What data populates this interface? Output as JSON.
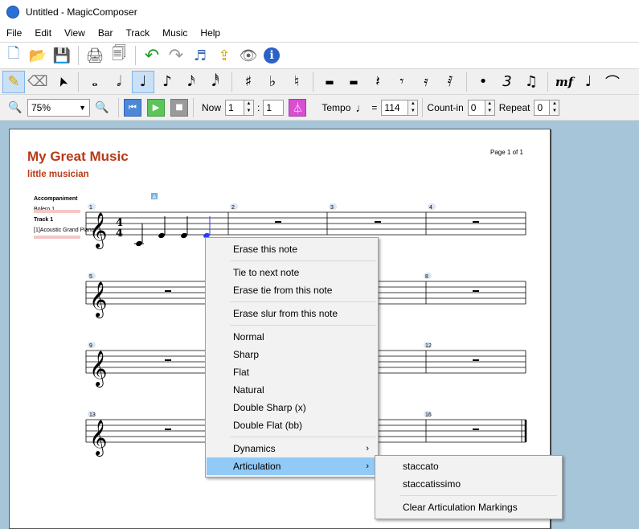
{
  "window": {
    "title": "Untitled - MagicComposer"
  },
  "menu": [
    "File",
    "Edit",
    "View",
    "Bar",
    "Track",
    "Music",
    "Help"
  ],
  "toolbar1": {
    "icons": [
      "new-document-icon",
      "open-folder-icon",
      "save-icon",
      "print-icon",
      "print-preview-icon",
      "undo-icon",
      "redo-icon",
      "score-settings-icon",
      "import-icon",
      "view-icon",
      "info-icon"
    ],
    "glyphs": [
      "🗋",
      "📂",
      "💾",
      "🖨",
      "🗐",
      "↶",
      "↷",
      "♬",
      "⇪",
      "👁",
      "ℹ"
    ]
  },
  "toolbar2": {
    "tools": [
      {
        "name": "pencil-icon",
        "glyph": "✎",
        "active": true
      },
      {
        "name": "eraser-icon",
        "glyph": "⌫",
        "active": false
      },
      {
        "name": "pointer-icon",
        "glyph": "➤",
        "active": false
      }
    ],
    "notes": [
      {
        "name": "whole-note-icon",
        "glyph": "𝅝",
        "active": false
      },
      {
        "name": "half-note-icon",
        "glyph": "𝅗𝅥",
        "active": false
      },
      {
        "name": "quarter-note-icon",
        "glyph": "♩",
        "active": true
      },
      {
        "name": "eighth-note-icon",
        "glyph": "♪",
        "active": false
      },
      {
        "name": "sixteenth-note-icon",
        "glyph": "𝅘𝅥𝅯",
        "active": false
      },
      {
        "name": "thirty-second-note-icon",
        "glyph": "𝅘𝅥𝅰",
        "active": false
      }
    ],
    "accidentals": [
      {
        "name": "sharp-icon",
        "glyph": "♯"
      },
      {
        "name": "flat-icon",
        "glyph": "♭"
      },
      {
        "name": "natural-icon",
        "glyph": "♮"
      }
    ],
    "rests": [
      {
        "name": "whole-rest-icon",
        "glyph": "▬"
      },
      {
        "name": "half-rest-icon",
        "glyph": "▬"
      },
      {
        "name": "quarter-rest-icon",
        "glyph": "𝄽"
      },
      {
        "name": "eighth-rest-icon",
        "glyph": "𝄾"
      },
      {
        "name": "sixteenth-rest-icon",
        "glyph": "𝄿"
      },
      {
        "name": "thirty-second-rest-icon",
        "glyph": "𝅀"
      }
    ],
    "extras": [
      {
        "name": "dot-icon",
        "glyph": "•"
      },
      {
        "name": "triplet-icon",
        "glyph": "3"
      },
      {
        "name": "tie-notes-icon",
        "glyph": "♫"
      },
      {
        "name": "dynamics-icon",
        "glyph": "mf"
      },
      {
        "name": "accent-note-icon",
        "glyph": "♩"
      },
      {
        "name": "slur-icon",
        "glyph": "⌒"
      }
    ]
  },
  "toolbar3": {
    "zoom_value": "75%",
    "now_label": "Now",
    "now_bar": "1",
    "now_colon": ":",
    "now_beat": "1",
    "tempo_label": "Tempo",
    "tempo_equals": "=",
    "tempo_value": "114",
    "countin_label": "Count-in",
    "countin_value": "0",
    "repeat_label": "Repeat",
    "repeat_value": "0"
  },
  "score": {
    "title": "My Great Music",
    "subtitle": "little musician",
    "page": "Page 1 of 1",
    "tracks_header": "Accompaniment",
    "accompaniment": "Bolero 1",
    "track_name": "Track 1",
    "instrument": "[1]Acoustic Grand Piano",
    "marker": "A",
    "time_top": "4",
    "time_bottom": "4",
    "bar_numbers": [
      "1",
      "2",
      "3",
      "4",
      "5",
      "8",
      "9",
      "12",
      "13",
      "16"
    ]
  },
  "context_menu": {
    "items": [
      "Erase this note",
      "Tie to next note",
      "Erase tie from this note",
      "Erase slur from this note",
      "Normal",
      "Sharp",
      "Flat",
      "Natural",
      "Double Sharp (x)",
      "Double Flat (bb)",
      "Dynamics",
      "Articulation"
    ],
    "submenu_arrow": "›"
  },
  "articulation_submenu": {
    "items": [
      "staccato",
      "staccatissimo",
      "Clear Articulation Markings"
    ]
  },
  "colors": {
    "title": "#b83a17",
    "workspace": "#a7c5d8",
    "highlight": "#91c9f7",
    "selected_note": "#2a3ff0"
  }
}
